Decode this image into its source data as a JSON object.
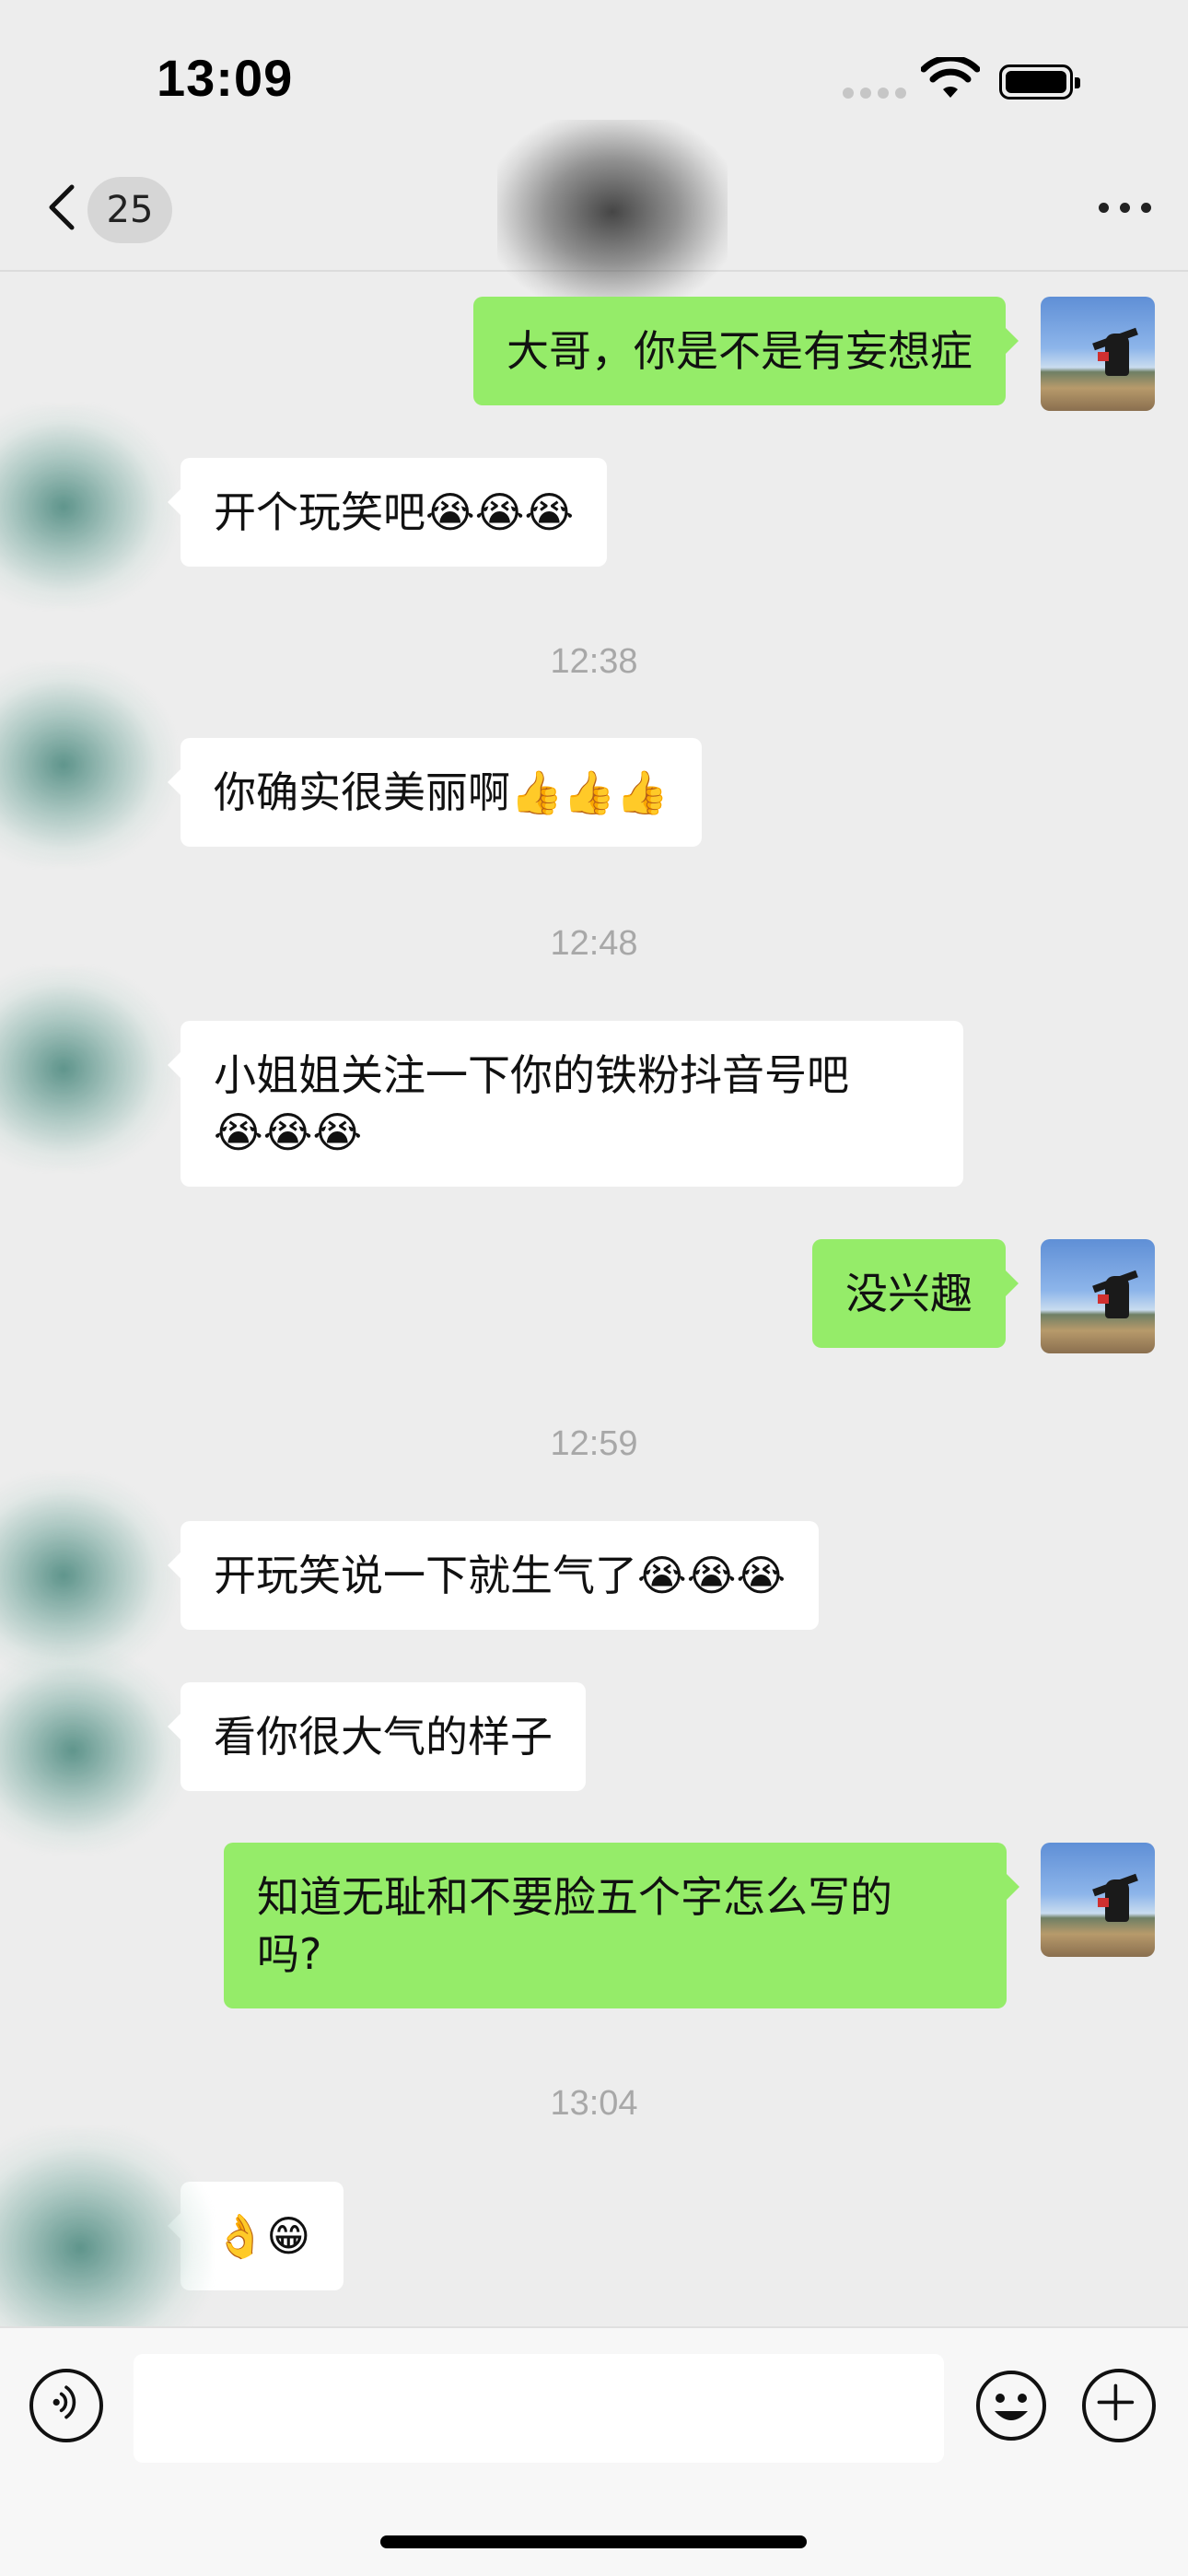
{
  "status_bar": {
    "time": "13:09"
  },
  "nav": {
    "unread_count": "25",
    "contact_name": ""
  },
  "messages": [
    {
      "side": "out",
      "text": "大哥，你是不是有妄想症"
    },
    {
      "side": "in",
      "text": "开个玩笑吧😭😭😭"
    },
    {
      "type": "time",
      "text": "12:38"
    },
    {
      "side": "in",
      "text": "你确实很美丽啊👍👍👍"
    },
    {
      "type": "time",
      "text": "12:48"
    },
    {
      "side": "in",
      "line1": "小姐姐关注一下你的铁粉抖音号吧",
      "line2": "😭😭😭"
    },
    {
      "side": "out",
      "text": "没兴趣"
    },
    {
      "type": "time",
      "text": "12:59"
    },
    {
      "side": "in",
      "text": "开玩笑说一下就生气了😭😭😭"
    },
    {
      "side": "in",
      "text": "看你很大气的样子"
    },
    {
      "side": "out",
      "line1": "知道无耻和不要脸五个字怎么写的",
      "line2": "吗?"
    },
    {
      "type": "time",
      "text": "13:04"
    },
    {
      "side": "in",
      "text": "👌😁"
    }
  ],
  "input": {
    "placeholder": ""
  },
  "icons": [
    "back-icon",
    "voice-icon",
    "emoji-icon",
    "plus-icon",
    "more-icon",
    "wifi-icon",
    "battery-icon"
  ],
  "colors": {
    "background": "#ededed",
    "outgoing_bubble": "#95ec69",
    "incoming_bubble": "#ffffff",
    "timestamp": "#a8a8a8"
  }
}
